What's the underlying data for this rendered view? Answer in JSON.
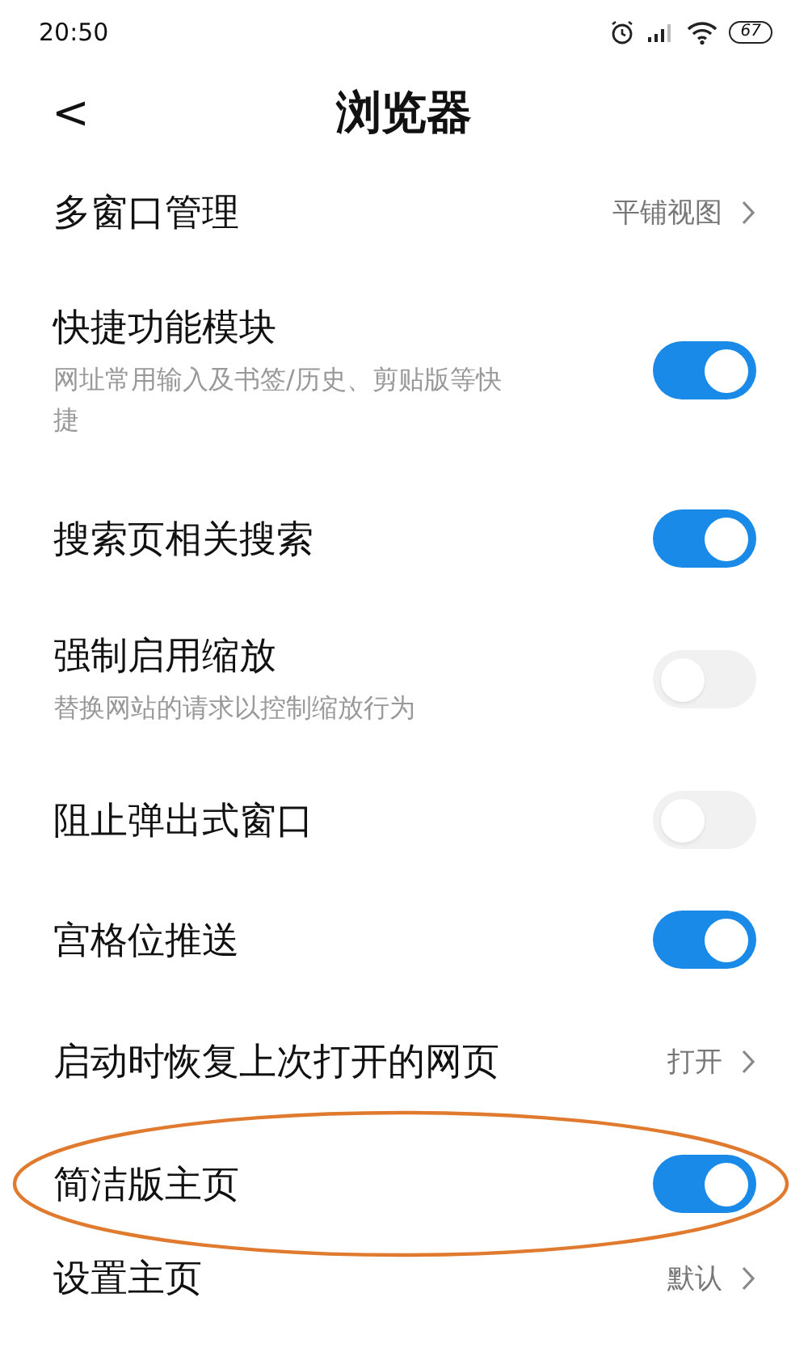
{
  "status_bar": {
    "time": "20:50",
    "battery": "67"
  },
  "header": {
    "back": "<",
    "title": "浏览器"
  },
  "rows": [
    {
      "kind": "link",
      "title": "多窗口管理",
      "value": "平铺视图"
    },
    {
      "kind": "toggle",
      "title": "快捷功能模块",
      "subtitle": "网址常用输入及书签/历史、剪贴版等快捷",
      "on": true
    },
    {
      "kind": "toggle",
      "title": "搜索页相关搜索",
      "on": true
    },
    {
      "kind": "toggle",
      "title": "强制启用缩放",
      "subtitle": "替换网站的请求以控制缩放行为",
      "on": false
    },
    {
      "kind": "toggle",
      "title": "阻止弹出式窗口",
      "on": false
    },
    {
      "kind": "toggle",
      "title": "宫格位推送",
      "on": true
    },
    {
      "kind": "link",
      "title": "启动时恢复上次打开的网页",
      "value": "打开"
    },
    {
      "kind": "toggle",
      "title": "简洁版主页",
      "on": true,
      "annotated": true
    },
    {
      "kind": "link",
      "title": "设置主页",
      "value": "默认"
    }
  ]
}
